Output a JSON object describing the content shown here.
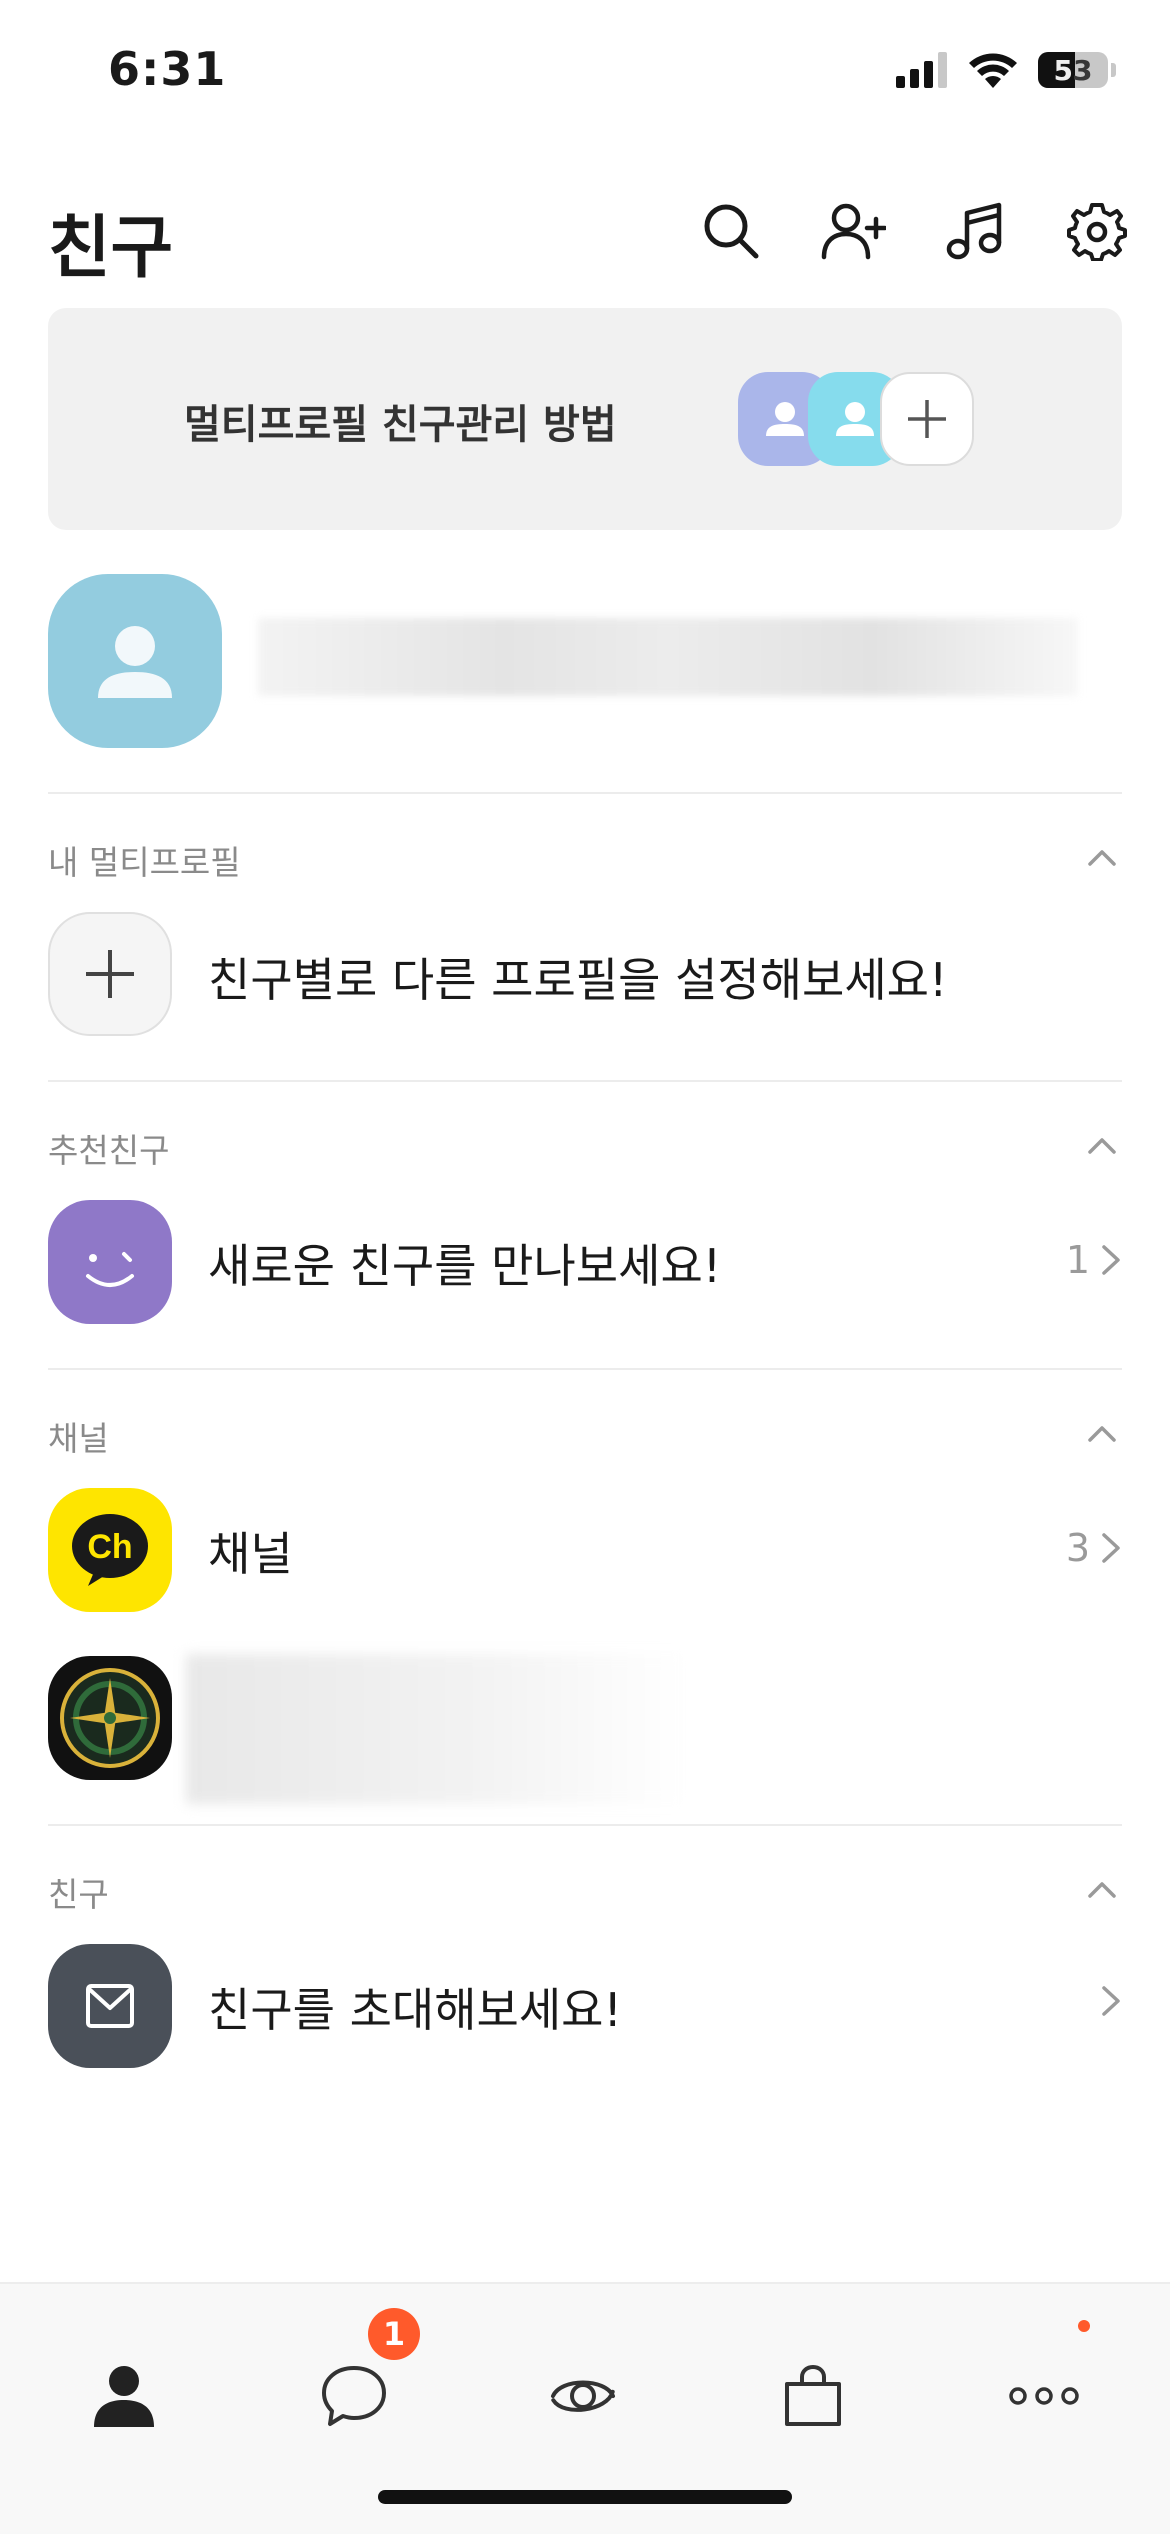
{
  "status_bar": {
    "time": "6:31",
    "battery": "53"
  },
  "header": {
    "title": "친구"
  },
  "banner": {
    "text": "멀티프로필 친구관리 방법"
  },
  "sections": {
    "multi_profile": {
      "label": "내 멀티프로필",
      "row_text": "친구별로 다른 프로필을 설정해보세요!"
    },
    "recommended": {
      "label": "추천친구",
      "row_text": "새로운 친구를 만나보세요!",
      "count": "1"
    },
    "channel": {
      "label": "채널",
      "row_text": "채널",
      "count": "3",
      "channel_logo_text": "Ch"
    },
    "friends": {
      "label": "친구",
      "row_text": "친구를 초대해보세요!"
    }
  },
  "bottom_nav": {
    "items": [
      "friends-tab",
      "chats-tab",
      "view-tab",
      "shopping-tab",
      "more-tab"
    ],
    "chat_badge": "1"
  },
  "colors": {
    "accent_badge": "#ff5a2b",
    "profile_avatar": "#93ccdf",
    "recommend_icon": "#8f78c8",
    "channel_icon": "#fee500",
    "invite_icon": "#4a5059"
  }
}
